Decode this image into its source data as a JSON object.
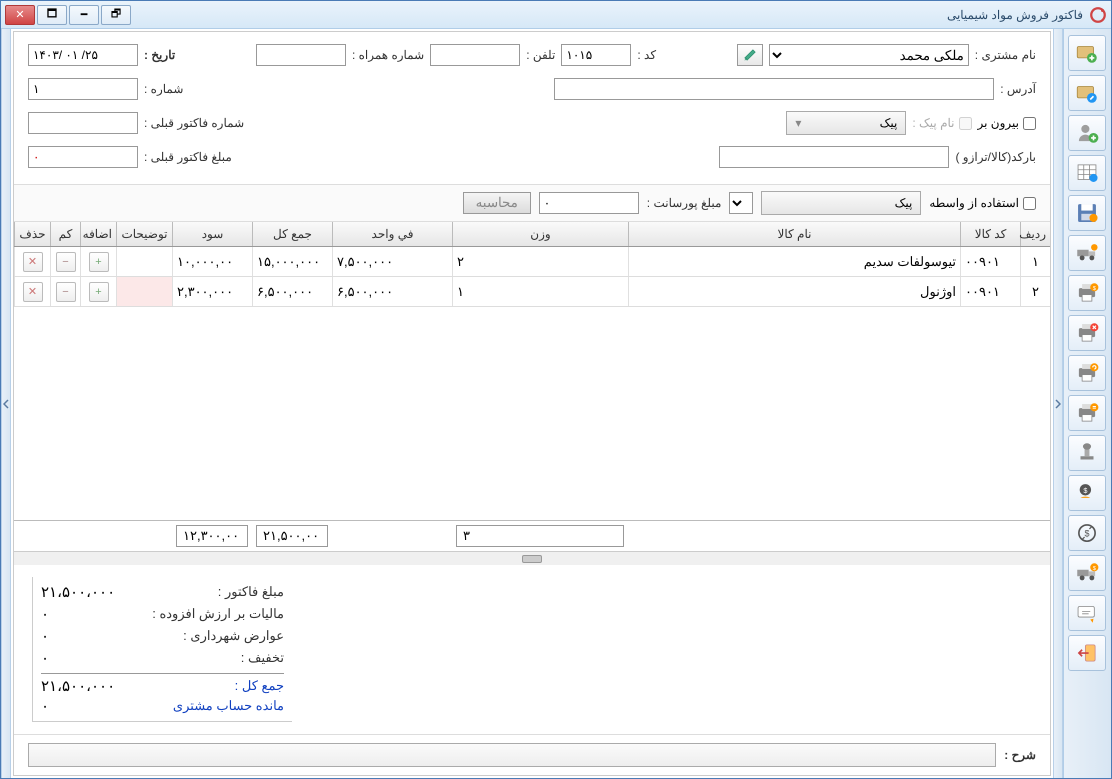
{
  "window": {
    "title": "فاکتور فروش مواد شیمیایی"
  },
  "form": {
    "customer_name_label": "نام مشتری :",
    "customer_name": "ملکی محمد",
    "code_label": "کد :",
    "code": "۱۰۱۵",
    "phone_label": "تلفن   :",
    "phone": "",
    "mobile_label": "شماره همراه :",
    "mobile": "",
    "date_label": "تاریخ :",
    "date": "۱۴۰۳/ ۰۱ /۲۵",
    "address_label": "آدرس    :",
    "address": "",
    "number_label": "شماره :",
    "number": "۱",
    "courier_out_label": "بیرون بر",
    "courier_name_label": "نام پیک :",
    "courier_value": "پیک",
    "prev_invoice_label": "شماره فاکتور قبلی :",
    "prev_invoice": "",
    "barcode_label": "بارکد(کالا/ترازو )",
    "barcode": "",
    "prev_amount_label": "مبلغ فاکتور قبلی :",
    "prev_amount": "٠",
    "use_agent_label": "استفاده از واسطه",
    "agent_value": "پیک",
    "commission_label": "مبلغ پورسانت :",
    "commission": "٠",
    "calc_btn": "محاسبه"
  },
  "grid": {
    "headers": {
      "row": "ردیف",
      "code": "کد کالا",
      "name": "نام کالا",
      "weight": "وزن",
      "unit_price": "في واحد",
      "total": "جمع کل",
      "profit": "سود",
      "desc": "توضیحات",
      "add": "اضافه",
      "sub": "کم",
      "del": "حذف"
    },
    "rows": [
      {
        "row": "۱",
        "code": "۰۰۹۰۱",
        "name": "تیوسولفات سدیم",
        "weight": "۲",
        "unit": "۷,۵۰۰,۰۰۰",
        "total": "۱۵,۰۰۰,۰۰۰",
        "profit": "۱۰,۰۰۰,۰۰"
      },
      {
        "row": "۲",
        "code": "۰۰۹۰۱",
        "name": "اوژنول",
        "weight": "۱",
        "unit": "۶,۵۰۰,۰۰۰",
        "total": "۶,۵۰۰,۰۰۰",
        "profit": "۲,۳۰۰,۰۰۰"
      }
    ],
    "footer": {
      "weight_total": "۳",
      "grand_total": "۲۱,۵۰۰,۰۰",
      "profit_total": "۱۲,۳۰۰,۰۰"
    }
  },
  "summary": {
    "invoice_total_label": "مبلغ فاکتور",
    "invoice_total": "۲۱،۵۰۰،۰۰۰",
    "vat_label": "مالیات بر ارزش افزوده  :",
    "vat": "٠",
    "municipal_label": "عوارض شهرداری  :",
    "municipal": "٠",
    "discount_label": "تخفیف  :",
    "discount": "٠",
    "total_label": "جمع کل",
    "total": "۲۱،۵۰۰،۰۰۰",
    "balance_label": "مانده حساب مشتری",
    "balance": "٠"
  },
  "description_label": "شرح :"
}
